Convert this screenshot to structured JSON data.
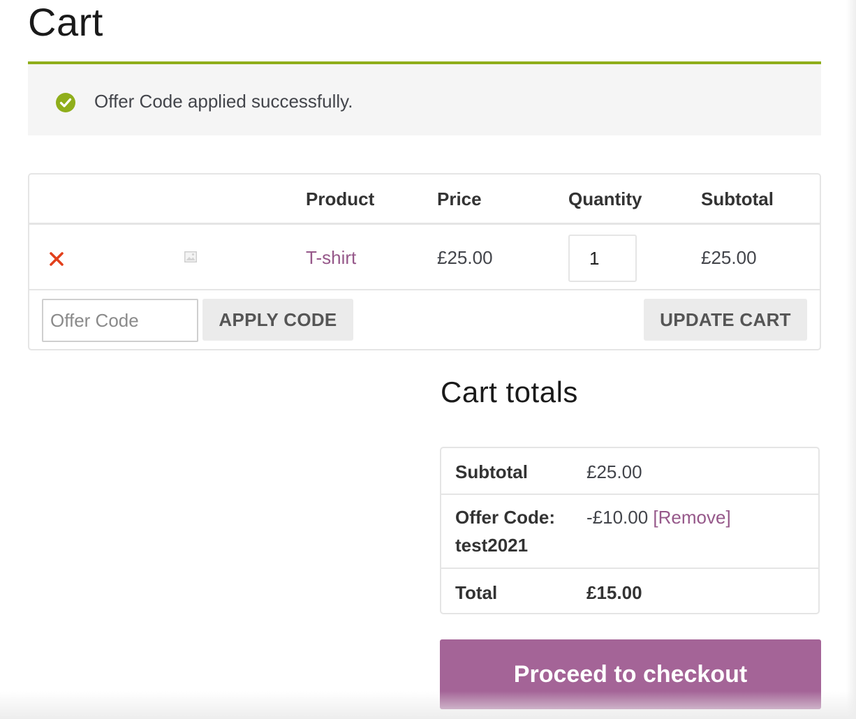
{
  "page": {
    "title": "Cart"
  },
  "notice": {
    "message": "Offer Code applied successfully.",
    "color": "#8fae1b"
  },
  "cart_table": {
    "headers": {
      "product": "Product",
      "price": "Price",
      "quantity": "Quantity",
      "subtotal": "Subtotal"
    },
    "rows": [
      {
        "product": "T-shirt",
        "price": "£25.00",
        "quantity": "1",
        "subtotal": "£25.00"
      }
    ]
  },
  "actions": {
    "coupon_placeholder": "Offer Code",
    "apply_label": "APPLY CODE",
    "update_label": "UPDATE CART"
  },
  "totals": {
    "title": "Cart totals",
    "subtotal_label": "Subtotal",
    "subtotal_value": "£25.00",
    "offer_label_line1": "Offer Code:",
    "offer_label_line2": "test2021",
    "offer_value": "-£10.00",
    "offer_remove": "[Remove]",
    "total_label": "Total",
    "total_value": "£15.00"
  },
  "checkout": {
    "label": "Proceed to checkout"
  },
  "colors": {
    "brand": "#a46497",
    "link": "#96588a",
    "remove": "#e2401c",
    "success": "#8fae1b"
  }
}
